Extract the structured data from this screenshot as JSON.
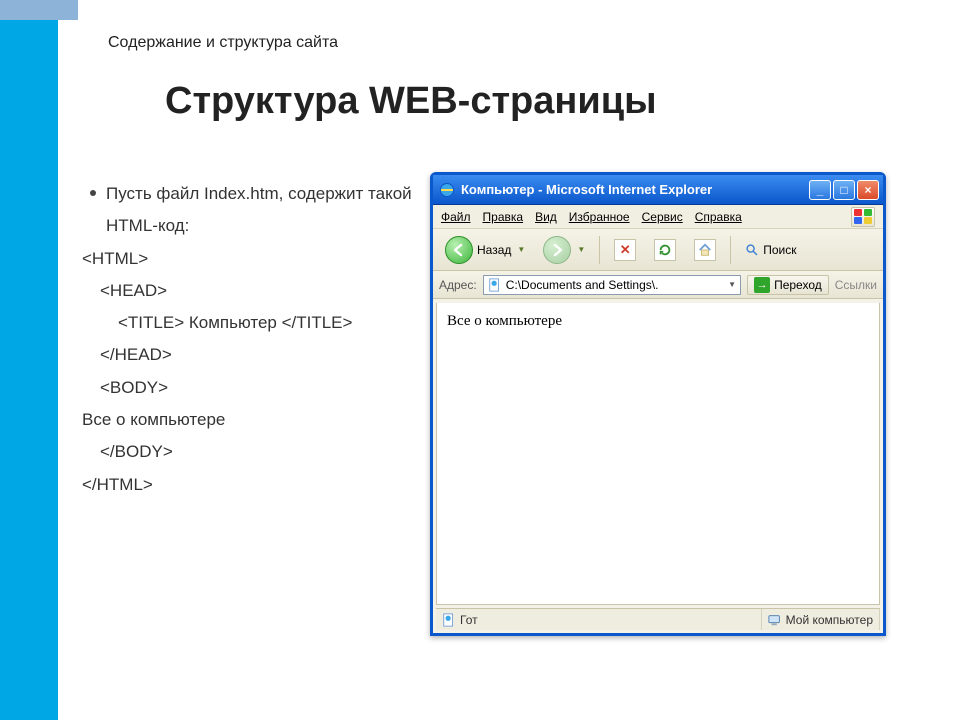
{
  "slide": {
    "subtitle": "Содержание и структура сайта",
    "title": "Структура WEB-страницы"
  },
  "left": {
    "bullet": "Пусть  файл Index.htm, содержит такой HTML-код:",
    "code": {
      "l1": "<HTML>",
      "l2": "<HEAD>",
      "l3": "<TITLE> Компьютер </TITLE>",
      "l4": "</HEAD>",
      "l5": "<BODY>",
      "l6": "Все о компьютере",
      "l7": "</BODY>",
      "l8": "</HTML>"
    }
  },
  "ie": {
    "title": "Компьютер - Microsoft Internet Explorer",
    "menu": {
      "file": "Файл",
      "edit": "Правка",
      "view": "Вид",
      "fav": "Избранное",
      "tools": "Сервис",
      "help": "Справка"
    },
    "toolbar": {
      "back": "Назад",
      "search": "Поиск"
    },
    "address": {
      "label": "Адрес:",
      "value": "C:\\Documents and Settings\\.",
      "go": "Переход",
      "links": "Ссылки"
    },
    "page_text": "Все о компьютере",
    "status": {
      "left": "Гот",
      "right": "Мой компьютер"
    }
  }
}
